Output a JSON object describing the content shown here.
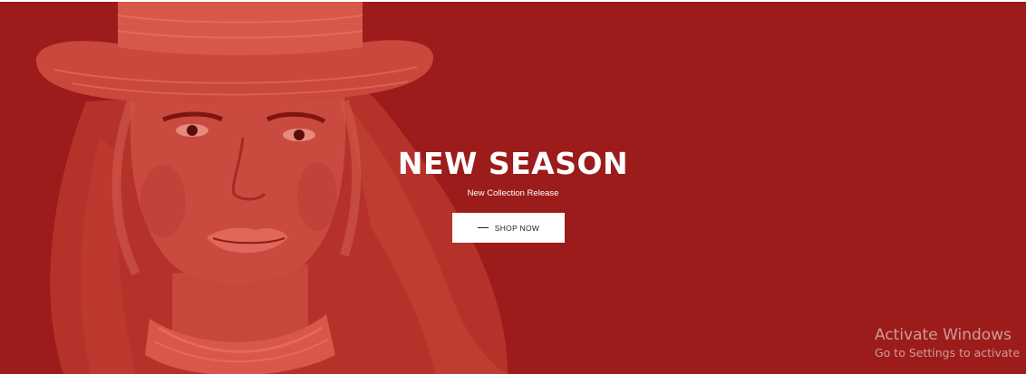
{
  "hero": {
    "background_color": "#9b1c1a",
    "title": "NEW SEASON",
    "subtitle": "New Collection Release",
    "cta_label": "SHOP NOW",
    "image": "woman-in-hat-portrait"
  },
  "watermark": {
    "title": "Activate Windows",
    "subtitle": "Go to Settings to activate"
  }
}
